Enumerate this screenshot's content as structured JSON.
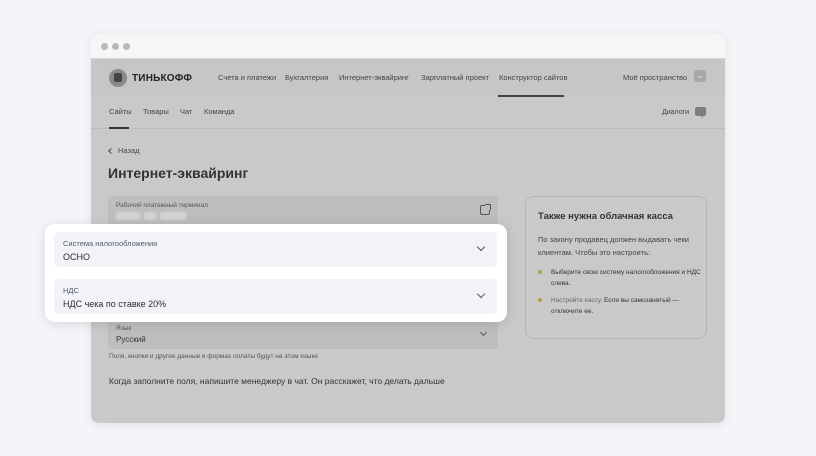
{
  "brand": {
    "name": "ТИНЬКОФФ",
    "logo_icon": "tinkoff-shield-logo"
  },
  "top_nav": {
    "items": [
      {
        "label": "Счета и платежи",
        "active": false
      },
      {
        "label": "Бухгалтерия",
        "active": false
      },
      {
        "label": "Интернет-эквайринг",
        "active": false
      },
      {
        "label": "Зарплатный проект",
        "active": false
      },
      {
        "label": "Конструктор сайтов",
        "active": true
      }
    ],
    "space_label": "Моё пространство",
    "space_icon": "chevron-down-icon"
  },
  "sub_nav": {
    "items": [
      {
        "label": "Сайты",
        "active": true
      },
      {
        "label": "Товары",
        "active": false
      },
      {
        "label": "Чат",
        "active": false
      },
      {
        "label": "Команда",
        "active": false
      }
    ],
    "dialogs_label": "Диалоги",
    "dialogs_icon": "chat-icon"
  },
  "back_label": "Назад",
  "page_title": "Интернет-эквайринг",
  "terminal_field": {
    "label": "Рабочий платежный терминал",
    "value_hidden": true,
    "icon": "external-link-icon"
  },
  "language_field": {
    "label": "Язык",
    "value": "Русский"
  },
  "language_hint": "Поля, кнопки и другие данные в формах оплаты будут на этом языке",
  "footer_text": "Когда заполните поля, напишите менеджеру в чат. Он расскажет, что делать дальше",
  "side_card": {
    "title": "Также нужна облачная касса",
    "text": "По закону продавец должен выдавать чеки клиентам. Чтобы это настроить:",
    "bullets": [
      {
        "link": "",
        "text": "Выберите свою систему налогообложения и НДС слева."
      },
      {
        "link": "Настройте кассу.",
        "text": " Если вы самозанятый — отключите ее."
      }
    ],
    "bullet_color": "#b0a03a"
  },
  "popup": {
    "tax_system": {
      "label": "Система налогообложения",
      "value": "ОСНО"
    },
    "vat": {
      "label": "НДС",
      "value": "НДС чека по ставке 20%"
    }
  }
}
